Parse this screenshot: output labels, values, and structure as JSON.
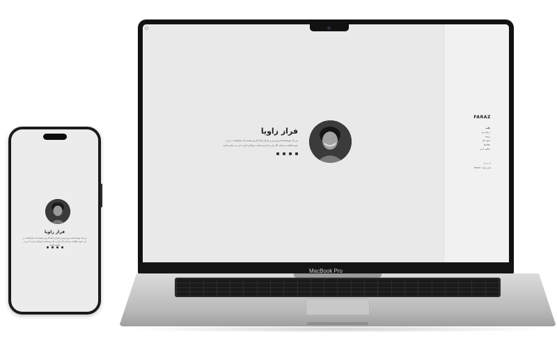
{
  "phone": {
    "name": "فراز زاویا",
    "bio": "من یک توسعه‌دهنده وردپرس و طراح رابط کاربری هستم که سال‌هاست در این حوزه فعالیت می‌کنم. اگر نیاز به یک وب‌سایت حرفه‌ای دارید با من در تماس باشید."
  },
  "laptop": {
    "model_label": "MacBook Pro",
    "hero": {
      "name": "فراز زاویا",
      "bio": "من یک توسعه‌دهنده وردپرس و طراح رابط کاربری هستم که سال‌هاست در این حوزه فعالیت می‌کنم. اگر نیاز به یک وب‌سایت حرفه‌ای دارید با من در تماس باشید."
    },
    "sidebar": {
      "brand": "FARAZ",
      "nav": [
        "خانه",
        "درباره من",
        "رزومه",
        "نمونه کار",
        "مقاله‌ها",
        "تماس با من"
      ],
      "footer_line1": "© ۱۴۰۲",
      "footer_line2": "فراز زاویا - FARAZ"
    }
  },
  "icons": [
    "instagram-icon",
    "linkedin-icon",
    "github-icon",
    "telegram-icon"
  ]
}
